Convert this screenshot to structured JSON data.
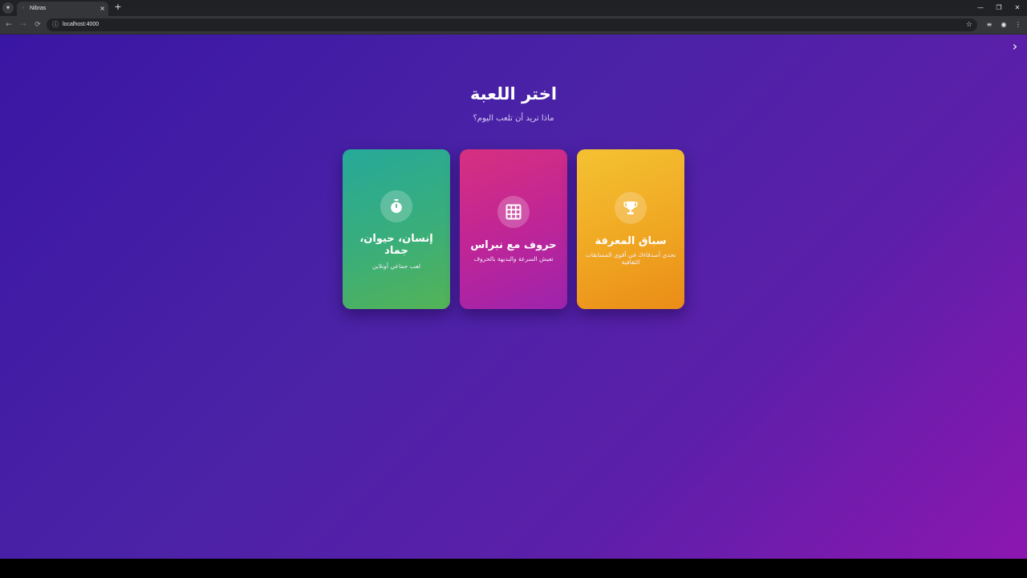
{
  "browser": {
    "tab_title": "Nibras",
    "url": "localhost:4000",
    "tab_close": "×",
    "new_tab": "+",
    "window_controls": {
      "minimize": "—",
      "restore": "❐",
      "close": "✕"
    }
  },
  "page": {
    "title": "اختر اللعبة",
    "subtitle": "ماذا تريد أن تلعب اليوم؟",
    "side_toggle": "›"
  },
  "cards": [
    {
      "title": "إنسان، حيوان، جماد",
      "description": "لعب جماعي أونلاين",
      "icon": "stopwatch-icon",
      "colors": {
        "start": "#26a99a",
        "end": "#54b356"
      }
    },
    {
      "title": "حروف مع نبراس",
      "description": "تعيش السرعة والبديهة بالحروف",
      "icon": "grid-icon",
      "colors": {
        "start": "#d7307f",
        "end": "#9d24ad"
      }
    },
    {
      "title": "سباق المعرفة",
      "description": "تحدى أصدقاءك في أقوى المسابقات الثقافية",
      "icon": "trophy-icon",
      "colors": {
        "start": "#f4c233",
        "end": "#ea8c17"
      }
    }
  ],
  "colors": {
    "background_start": "#3a16a4",
    "background_end": "#8c17b0",
    "text": "#ffffff"
  }
}
